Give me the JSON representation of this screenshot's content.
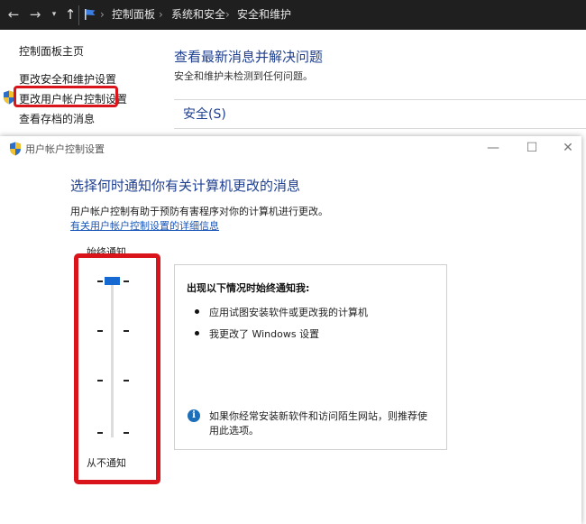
{
  "nav": {
    "back_glyph": "←",
    "forward_glyph": "→",
    "recent_glyph": "▾",
    "up_glyph": "↑"
  },
  "breadcrumb": {
    "items": [
      "控制面板",
      "系统和安全",
      "安全和维护"
    ],
    "separator": "›"
  },
  "sidebar": {
    "items": [
      {
        "label": "控制面板主页"
      },
      {
        "label": "更改安全和维护设置"
      },
      {
        "label": "更改用户帐户控制设置"
      },
      {
        "label": "查看存档的消息"
      }
    ]
  },
  "main": {
    "title": "查看最新消息并解决问题",
    "subtitle": "安全和维护未检测到任何问题。",
    "section_title": "安全(S)"
  },
  "dialog": {
    "title": "用户帐户控制设置",
    "minimize_glyph": "—",
    "maximize_glyph": "☐",
    "close_glyph": "✕",
    "headline": "选择何时通知你有关计算机更改的消息",
    "description": "用户帐户控制有助于预防有害程序对你的计算机进行更改。",
    "more_info_link": "有关用户帐户控制设置的详细信息",
    "slider": {
      "top_label": "始终通知",
      "bottom_label": "从不通知",
      "levels": 4,
      "selected_level": 4
    },
    "info_panel": {
      "title": "出现以下情况时始终通知我:",
      "bullets": [
        "应用试图安装软件或更改我的计算机",
        "我更改了 Windows 设置"
      ],
      "note": "如果你经常安装新软件和访问陌生网站，则推荐使用此选项。",
      "info_glyph": "i"
    }
  },
  "colors": {
    "accent_blue": "#1e3f91",
    "highlight_red": "#d9141b",
    "slider_thumb": "#1769d2",
    "topbar": "#1f1f1f"
  },
  "icons": [
    "back-arrow-icon",
    "forward-arrow-icon",
    "chevron-down-icon",
    "up-arrow-icon",
    "control-panel-flag-icon",
    "uac-shield-icon",
    "info-icon",
    "minimize-icon",
    "maximize-icon",
    "close-icon"
  ]
}
